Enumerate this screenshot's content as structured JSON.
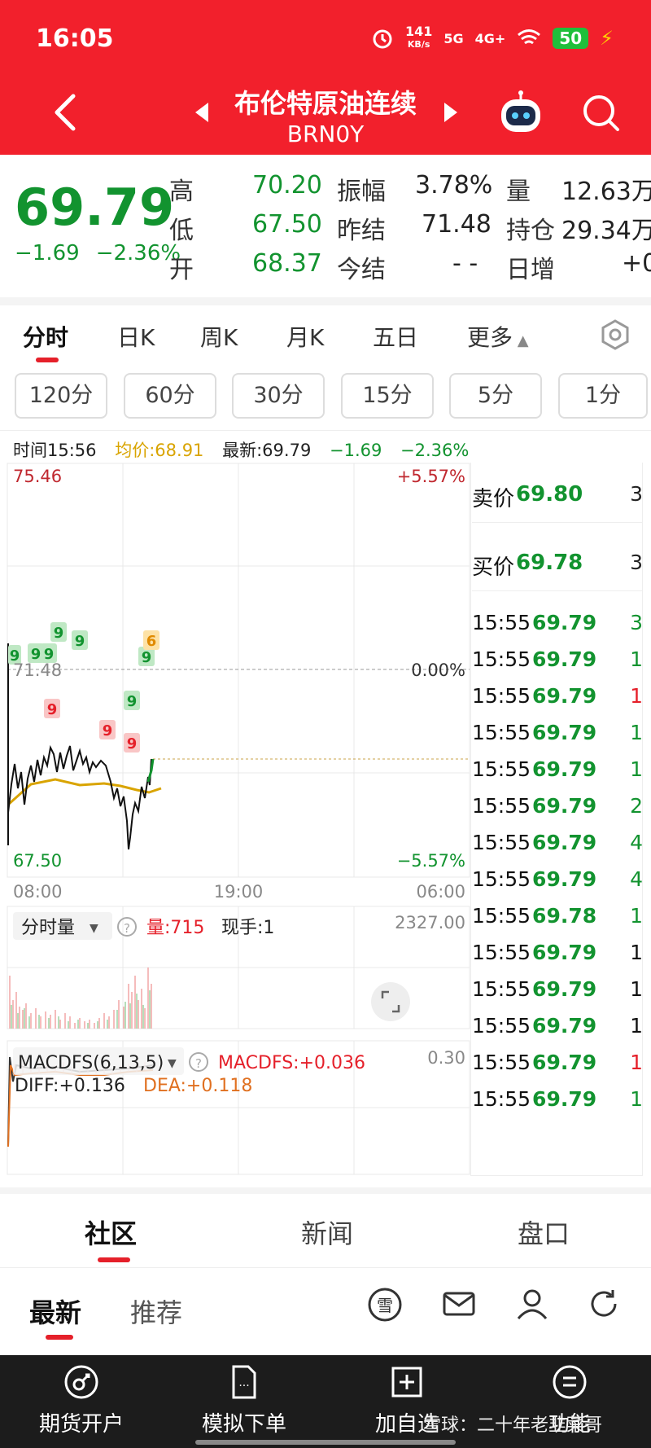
{
  "status_bar": {
    "time": "16:05",
    "net_speed_top": "141",
    "net_speed_bottom": "KB/s",
    "sig1": "5G",
    "sig2": "4G+",
    "battery": "50"
  },
  "header": {
    "name": "布伦特原油连续",
    "code": "BRN0Y"
  },
  "quote": {
    "price": "69.79",
    "change": "−1.69",
    "change_pct": "−2.36%",
    "high_label": "高",
    "high": "70.20",
    "low_label": "低",
    "low": "67.50",
    "open_label": "开",
    "open": "68.37",
    "amp_label": "振幅",
    "amp": "3.78%",
    "prev_settle_label": "昨结",
    "prev_settle": "71.48",
    "settle_label": "今结",
    "settle": "- -",
    "vol_label": "量",
    "vol": "12.63万",
    "oi_label": "持仓",
    "oi": "29.34万",
    "daily_inc_label": "日增",
    "daily_inc": "+0"
  },
  "tabs": [
    "分时",
    "日K",
    "周K",
    "月K",
    "五日",
    "更多"
  ],
  "intervals": [
    "120分",
    "60分",
    "30分",
    "15分",
    "5分",
    "1分"
  ],
  "info_line": {
    "time": "时间15:56",
    "avg": "均价:68.91",
    "latest": "最新:69.79",
    "chg": "−1.69",
    "pct": "−2.36%"
  },
  "chart": {
    "y_top": "75.46",
    "y_mid": "71.48",
    "y_bot": "67.50",
    "pct_top": "+5.57%",
    "pct_mid": "0.00%",
    "pct_bot": "−5.57%",
    "x_ticks": [
      "08:00",
      "19:00",
      "06:00"
    ],
    "vol_label": "分时量",
    "vol_val": "量:715",
    "vol_now": "现手:1",
    "vol_max": "2327.00",
    "macd_label": "MACDFS(6,13,5)",
    "macd_val": "MACDFS:+0.036",
    "macd_max": "0.30",
    "diff": "DIFF:+0.136",
    "dea": "DEA:+0.118",
    "signal_green": "9",
    "signal_red": "9",
    "signal_orange": "6"
  },
  "tape": {
    "ask_label": "卖价",
    "ask_price": "69.80",
    "ask_qty": "3",
    "bid_label": "买价",
    "bid_price": "69.78",
    "bid_qty": "3",
    "trades": [
      {
        "time": "15:55",
        "price": "69.79",
        "qty": "3",
        "dir": "green"
      },
      {
        "time": "15:55",
        "price": "69.79",
        "qty": "1",
        "dir": "green"
      },
      {
        "time": "15:55",
        "price": "69.79",
        "qty": "1",
        "dir": "red"
      },
      {
        "time": "15:55",
        "price": "69.79",
        "qty": "1",
        "dir": "green"
      },
      {
        "time": "15:55",
        "price": "69.79",
        "qty": "1",
        "dir": "green"
      },
      {
        "time": "15:55",
        "price": "69.79",
        "qty": "2",
        "dir": "green"
      },
      {
        "time": "15:55",
        "price": "69.79",
        "qty": "4",
        "dir": "green"
      },
      {
        "time": "15:55",
        "price": "69.79",
        "qty": "4",
        "dir": "green"
      },
      {
        "time": "15:55",
        "price": "69.78",
        "qty": "1",
        "dir": "green"
      },
      {
        "time": "15:55",
        "price": "69.79",
        "qty": "1",
        "dir": "black"
      },
      {
        "time": "15:55",
        "price": "69.79",
        "qty": "1",
        "dir": "black"
      },
      {
        "time": "15:55",
        "price": "69.79",
        "qty": "1",
        "dir": "black"
      },
      {
        "time": "15:55",
        "price": "69.79",
        "qty": "1",
        "dir": "red"
      },
      {
        "time": "15:55",
        "price": "69.79",
        "qty": "1",
        "dir": "green"
      }
    ]
  },
  "bottom_tabs": [
    "社区",
    "新闻",
    "盘口"
  ],
  "feed_tabs": [
    "最新",
    "推荐"
  ],
  "feed_icons": [
    "snowball-icon",
    "mail-icon",
    "user-icon",
    "refresh-icon"
  ],
  "nav": [
    "期货开户",
    "模拟下单",
    "加自选",
    "功能"
  ],
  "watermark": "雪球：二十年老韭菜哥",
  "colors": {
    "red": "#f2202c",
    "green": "#12932f",
    "avg_line": "#d9a400"
  }
}
